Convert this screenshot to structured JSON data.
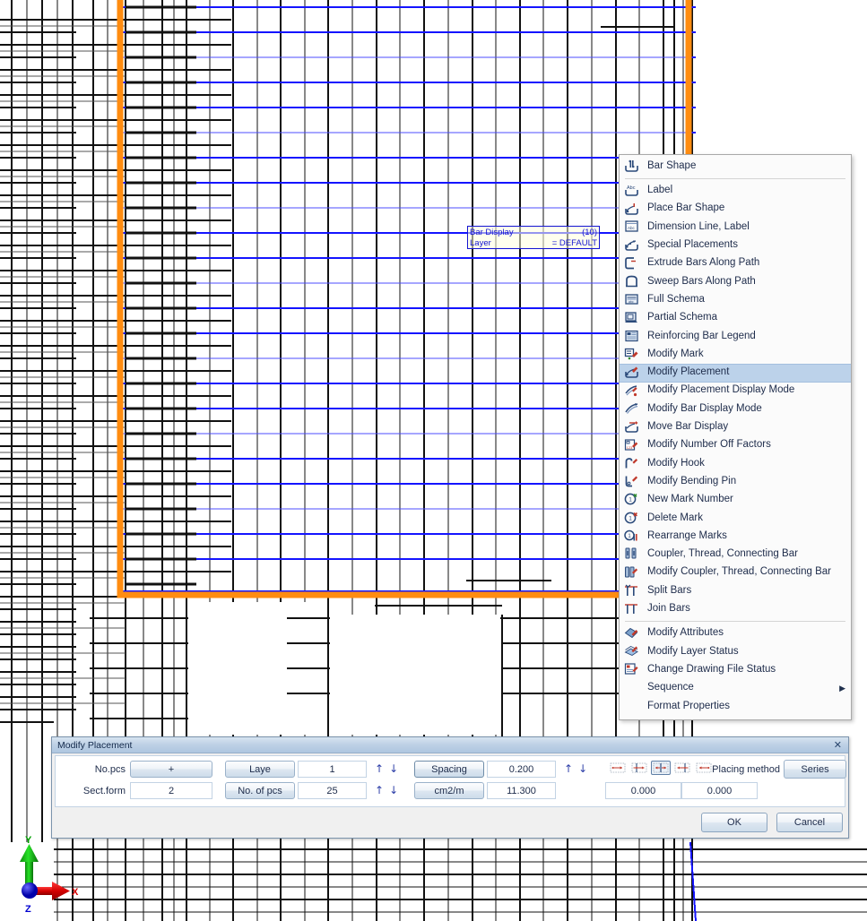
{
  "app": {
    "drawing_annotation": {
      "title": "Bar Display",
      "count": "(10)",
      "layer_label": "Layer",
      "layer_value": "= DEFAULT"
    },
    "axis_gizmo": {
      "x_label": "X",
      "y_label": "Y",
      "z_label": "Z",
      "x_color": "#d40000",
      "y_color": "#00a000",
      "z_color": "#0000d0"
    },
    "selection_color": "#ff8c10",
    "rebar_color": "#1414ff"
  },
  "context_menu": {
    "groups": [
      {
        "items": [
          {
            "label": "Bar Shape",
            "icon": "bar-shape-icon",
            "selected": false,
            "submenu": false
          }
        ]
      },
      {
        "items": [
          {
            "label": "Label",
            "icon": "label-icon",
            "selected": false,
            "submenu": false
          },
          {
            "label": "Place Bar Shape",
            "icon": "place-bar-shape-icon",
            "selected": false,
            "submenu": false
          },
          {
            "label": "Dimension Line, Label",
            "icon": "dimension-line-label-icon",
            "selected": false,
            "submenu": false
          },
          {
            "label": "Special Placements",
            "icon": "special-placements-icon",
            "selected": false,
            "submenu": false
          },
          {
            "label": "Extrude Bars Along Path",
            "icon": "extrude-bars-icon",
            "selected": false,
            "submenu": false
          },
          {
            "label": "Sweep Bars Along Path",
            "icon": "sweep-bars-icon",
            "selected": false,
            "submenu": false
          },
          {
            "label": "Full Schema",
            "icon": "full-schema-icon",
            "selected": false,
            "submenu": false
          },
          {
            "label": "Partial Schema",
            "icon": "partial-schema-icon",
            "selected": false,
            "submenu": false
          },
          {
            "label": "Reinforcing Bar Legend",
            "icon": "reinforcing-bar-legend-icon",
            "selected": false,
            "submenu": false
          },
          {
            "label": "Modify Mark",
            "icon": "modify-mark-icon",
            "selected": false,
            "submenu": false
          },
          {
            "label": "Modify Placement",
            "icon": "modify-placement-icon",
            "selected": true,
            "submenu": false
          },
          {
            "label": "Modify Placement Display Mode",
            "icon": "modify-placement-display-mode-icon",
            "selected": false,
            "submenu": false
          },
          {
            "label": "Modify Bar Display Mode",
            "icon": "modify-bar-display-mode-icon",
            "selected": false,
            "submenu": false
          },
          {
            "label": "Move Bar Display",
            "icon": "move-bar-display-icon",
            "selected": false,
            "submenu": false
          },
          {
            "label": "Modify Number Off Factors",
            "icon": "modify-number-off-factors-icon",
            "selected": false,
            "submenu": false
          },
          {
            "label": "Modify Hook",
            "icon": "modify-hook-icon",
            "selected": false,
            "submenu": false
          },
          {
            "label": "Modify Bending Pin",
            "icon": "modify-bending-pin-icon",
            "selected": false,
            "submenu": false
          },
          {
            "label": "New Mark Number",
            "icon": "new-mark-number-icon",
            "selected": false,
            "submenu": false
          },
          {
            "label": "Delete Mark",
            "icon": "delete-mark-icon",
            "selected": false,
            "submenu": false
          },
          {
            "label": "Rearrange Marks",
            "icon": "rearrange-marks-icon",
            "selected": false,
            "submenu": false
          },
          {
            "label": "Coupler, Thread, Connecting Bar",
            "icon": "coupler-thread-connecting-bar-icon",
            "selected": false,
            "submenu": false
          },
          {
            "label": "Modify Coupler, Thread, Connecting Bar",
            "icon": "modify-coupler-icon",
            "selected": false,
            "submenu": false
          },
          {
            "label": "Split Bars",
            "icon": "split-bars-icon",
            "selected": false,
            "submenu": false
          },
          {
            "label": "Join Bars",
            "icon": "join-bars-icon",
            "selected": false,
            "submenu": false
          }
        ]
      },
      {
        "items": [
          {
            "label": "Modify Attributes",
            "icon": "modify-attributes-icon",
            "selected": false,
            "submenu": false
          },
          {
            "label": "Modify Layer Status",
            "icon": "modify-layer-status-icon",
            "selected": false,
            "submenu": false
          },
          {
            "label": "Change Drawing File Status",
            "icon": "change-drawing-file-status-icon",
            "selected": false,
            "submenu": false
          },
          {
            "label": "Sequence",
            "icon": "",
            "selected": false,
            "submenu": true
          },
          {
            "label": "Format Properties",
            "icon": "",
            "selected": false,
            "submenu": false
          }
        ]
      }
    ],
    "submenu_arrow": "▶"
  },
  "dialog": {
    "title": "Modify Placement",
    "close_label": "✕",
    "row1": {
      "label": "No.pcs",
      "plus_button": "+",
      "layer_button": "Laye",
      "layer_value": "1",
      "up_arrow": "↑",
      "down_arrow": "↓",
      "mode_button": "Spacing",
      "mode_value": "0.200",
      "up_arrow2": "↑",
      "down_arrow2": "↓"
    },
    "row2": {
      "label": "Sect.form",
      "sect_value": "2",
      "pieces_button": "No. of pcs",
      "pieces_value": "25",
      "up_arrow": "↑",
      "down_arrow": "↓",
      "unit_button": "cm2/m",
      "unit_value": "11.300",
      "offset_left": "0.000",
      "offset_right": "0.000"
    },
    "placing": {
      "label": "Placing method",
      "value": "Series"
    },
    "spacing_modes": {
      "selected_index": 2,
      "options": [
        "spacing-mode-free-icon",
        "spacing-mode-left-icon",
        "spacing-mode-center-icon",
        "spacing-mode-right-icon",
        "spacing-mode-span-icon"
      ]
    },
    "buttons": {
      "ok": "OK",
      "cancel": "Cancel"
    }
  }
}
